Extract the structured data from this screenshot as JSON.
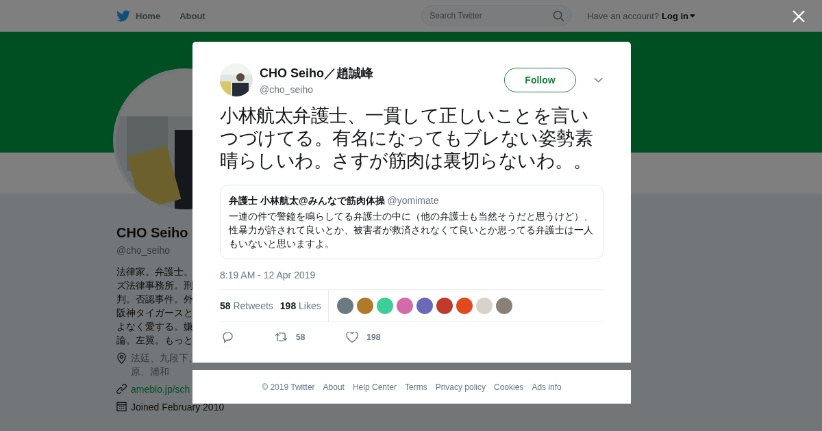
{
  "nav": {
    "home": "Home",
    "about": "About",
    "search_placeholder": "Search Twitter",
    "account_prompt": "Have an account?",
    "login": "Log in"
  },
  "profile": {
    "name": "CHO Seiho",
    "handle": "@cho_seiho",
    "bio_lines": [
      "法律家。弁護士。",
      "ズ法律事務所。刑",
      "判。否認事件。外",
      "阪神タイガースと",
      "よなく愛する。嫌",
      "論。左翼。もっと"
    ],
    "location_lines": [
      "法廷、九段下、",
      "原、浦和"
    ],
    "link": "ameblo.jp/sch",
    "joined": "Joined February 2010"
  },
  "tweet": {
    "name": "CHO Seiho／趙誠峰",
    "handle": "@cho_seiho",
    "follow": "Follow",
    "text": "小林航太弁護士、一貫して正しいことを言いつづけてる。有名になってもブレない姿勢素晴らしいわ。さすが筋肉は裏切らないわ。。",
    "quote": {
      "name": "弁護士 小林航太@みんなで筋肉体操",
      "handle": "@yomimate",
      "text": "一連の件で警鐘を鳴らしてる弁護士の中に（他の弁護士も当然そうだと思うけど）、性暴力が許されて良いとか、被害者が救済されなくて良いとか思ってる弁護士は一人もいないと思いますよ。"
    },
    "time": "8:19 AM - 12 Apr 2019",
    "retweets": {
      "count": "58",
      "label": "Retweets"
    },
    "likes": {
      "count": "198",
      "label": "Likes"
    },
    "likers": [
      {
        "color": "#6b7a80"
      },
      {
        "color": "#b07a2a"
      },
      {
        "color": "#3ccf9a"
      },
      {
        "color": "#d46aa8"
      },
      {
        "color": "#6a6ab8"
      },
      {
        "color": "#c0392b"
      },
      {
        "color": "#e04a1c"
      },
      {
        "color": "#d8d2c8"
      },
      {
        "color": "#8a8078"
      }
    ],
    "actions": {
      "retweet_count": "58",
      "like_count": "198"
    }
  },
  "footer": [
    "© 2019 Twitter",
    "About",
    "Help Center",
    "Terms",
    "Privacy policy",
    "Cookies",
    "Ads info"
  ]
}
